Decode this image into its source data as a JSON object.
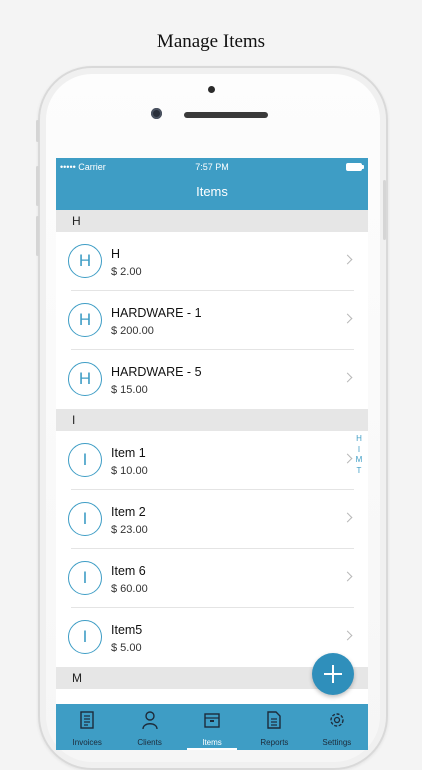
{
  "caption": "Manage Items",
  "statusbar": {
    "carrier": "••••• Carrier",
    "time": "7:57 PM"
  },
  "navbar": {
    "title": "Items"
  },
  "sections": [
    {
      "letter": "H",
      "items": [
        {
          "initial": "H",
          "name": "H",
          "price": "$ 2.00"
        },
        {
          "initial": "H",
          "name": "HARDWARE - 1",
          "price": "$ 200.00"
        },
        {
          "initial": "H",
          "name": "HARDWARE - 5",
          "price": "$ 15.00"
        }
      ]
    },
    {
      "letter": "I",
      "items": [
        {
          "initial": "I",
          "name": "Item 1",
          "price": "$ 10.00"
        },
        {
          "initial": "I",
          "name": "Item 2",
          "price": "$ 23.00"
        },
        {
          "initial": "I",
          "name": "Item 6",
          "price": "$ 60.00"
        },
        {
          "initial": "I",
          "name": "Item5",
          "price": "$ 5.00"
        }
      ]
    },
    {
      "letter": "M",
      "items": []
    }
  ],
  "index_bar": [
    "H",
    "I",
    "M",
    "T"
  ],
  "tabs": [
    {
      "label": "Invoices",
      "icon": "invoices-icon"
    },
    {
      "label": "Clients",
      "icon": "clients-icon"
    },
    {
      "label": "Items",
      "icon": "items-icon",
      "active": true
    },
    {
      "label": "Reports",
      "icon": "reports-icon"
    },
    {
      "label": "Settings",
      "icon": "settings-icon"
    }
  ],
  "colors": {
    "accent": "#3e9dc5",
    "fab": "#2f8fbb",
    "section_bg": "#e6e6e6"
  }
}
